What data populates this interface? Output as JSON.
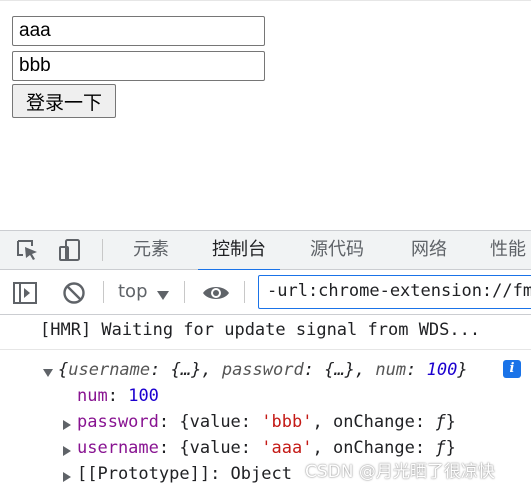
{
  "form": {
    "username_value": "aaa",
    "password_value": "bbb",
    "login_label": "登录一下"
  },
  "devtools": {
    "tabs": [
      {
        "label": "元素"
      },
      {
        "label": "控制台",
        "active": true
      },
      {
        "label": "源代码"
      },
      {
        "label": "网络"
      },
      {
        "label": "性能"
      }
    ],
    "context_label": "top",
    "filter_value": "-url:chrome-extension://fmkad",
    "accent_color": "#1a73e8"
  },
  "console": {
    "hmr_message": "[HMR] Waiting for update signal from WDS...",
    "object_summary": {
      "brace_open": "{",
      "k1": "username",
      "v1": "{…}",
      "k2": "password",
      "v2": "{…}",
      "k3": "num",
      "v3": "100",
      "brace_close": "}"
    },
    "info_badge": "i",
    "prop_num": {
      "key": "num",
      "value": "100"
    },
    "prop_password": {
      "key": "password",
      "k_value": "value",
      "str": "'bbb'",
      "k_onchange": "onChange",
      "fn": "ƒ"
    },
    "prop_username": {
      "key": "username",
      "k_value": "value",
      "str": "'aaa'",
      "k_onchange": "onChange",
      "fn": "ƒ"
    },
    "prop_prototype": {
      "key": "[[Prototype]]",
      "value": "Object"
    }
  },
  "watermark": "CSDN @月光晒了很凉快"
}
